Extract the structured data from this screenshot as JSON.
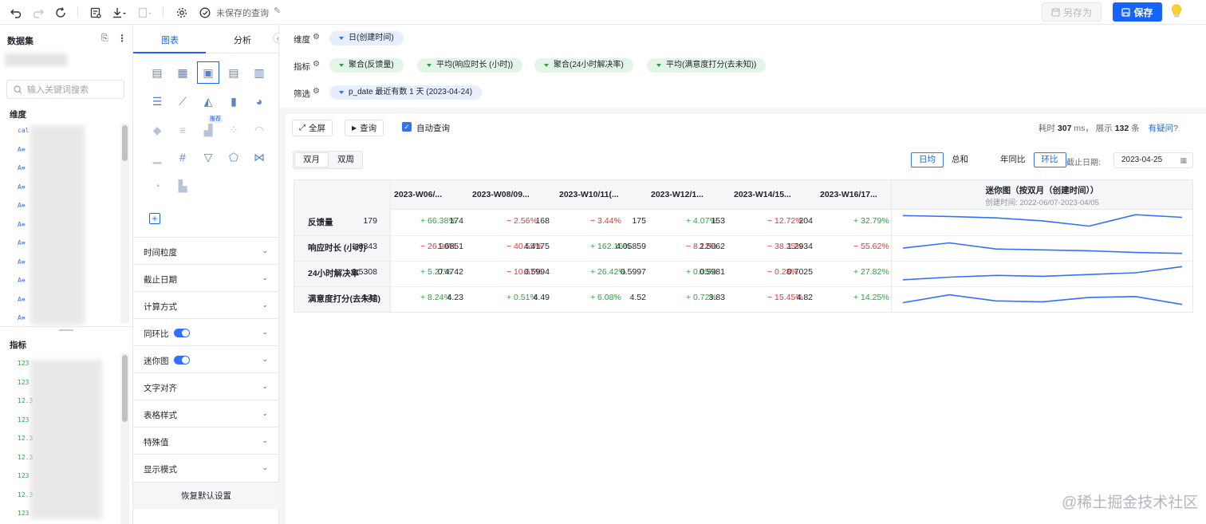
{
  "toolbar": {
    "unsaved_label": "未保存的查询",
    "save_as_label": "另存为",
    "save_label": "保存"
  },
  "left_panel": {
    "title": "数据集",
    "search_placeholder": "输入关键词搜索",
    "dimensions_label": "维度",
    "metrics_label": "指标",
    "dimension_icons": [
      "cal",
      "A≡",
      "A≡",
      "A≡",
      "A≡",
      "A≡",
      "A≡",
      "A≡",
      "A≡",
      "A≡",
      "A≡"
    ],
    "metric_icons": [
      "123",
      "123",
      "12.3",
      "123",
      "12.3",
      "12.3",
      "123",
      "12.3",
      "123"
    ]
  },
  "config_panel": {
    "tabs": [
      "图表",
      "分析"
    ],
    "recommend_badge": "推荐",
    "sections": [
      {
        "label": "时间粒度",
        "toggle": false
      },
      {
        "label": "截止日期",
        "toggle": false
      },
      {
        "label": "计算方式",
        "toggle": false
      },
      {
        "label": "同环比",
        "toggle": true
      },
      {
        "label": "迷你图",
        "toggle": true
      },
      {
        "label": "文字对齐",
        "toggle": false
      },
      {
        "label": "表格样式",
        "toggle": false
      },
      {
        "label": "特殊值",
        "toggle": false
      },
      {
        "label": "显示模式",
        "toggle": false
      }
    ],
    "reset_label": "恢复默认设置"
  },
  "shelves": {
    "dimension": {
      "label": "维度",
      "pills": [
        "日(创建时间)"
      ]
    },
    "metric": {
      "label": "指标",
      "pills": [
        "聚合(反馈量)",
        "平均(响应时长 (小时))",
        "聚合(24小时解决率)",
        "平均(满意度打分(去未知))"
      ]
    },
    "filter": {
      "label": "筛选",
      "pills": [
        "p_date 最近有数 1 天 (2023-04-24)"
      ]
    }
  },
  "query_bar": {
    "fullscreen_label": "全屏",
    "query_label": "查询",
    "auto_query_label": "自动查询",
    "auto_query_checked": true,
    "stats_prefix": "耗时",
    "time_value": "307",
    "time_unit": "ms，",
    "count_prefix": "展示",
    "count_value": "132",
    "count_unit": "条",
    "help_link": "有疑问?"
  },
  "controls": {
    "period_tabs": [
      "双月",
      "双周"
    ],
    "period_selected": "双月",
    "agg_tabs": [
      "日均",
      "总和"
    ],
    "agg_selected": "日均",
    "compare_tabs": [
      "年同比",
      "环比"
    ],
    "compare_selected": "环比",
    "cutoff_label": "截止日期:",
    "cutoff_value": "2023-04-25"
  },
  "table": {
    "columns": [
      "2023-W06/...",
      "2023-W08/09...",
      "2023-W10/11(...",
      "2023-W12/1...",
      "2023-W14/15...",
      "2023-W16/17..."
    ],
    "sparkline_title": "迷你图（按双月（创建时间））",
    "sparkline_subtitle": "创建时间: 2022-06/07-2023-04/05",
    "rows": [
      {
        "label": "反馈量",
        "values": [
          "179",
          "174",
          "168",
          "175",
          "153",
          "204"
        ],
        "changes": [
          "+ 66.38%",
          "− 2.56%",
          "− 3.44%",
          "+ 4.07%",
          "− 12.72%",
          "+ 32.79%"
        ],
        "dirs": [
          "up",
          "down",
          "down",
          "up",
          "down",
          "up"
        ]
      },
      {
        "label": "响应时长 (小时)",
        "values": [
          "1.8343",
          "1.6851",
          "4.4175",
          "4.05859",
          "2.5062",
          "1.2934"
        ],
        "changes": [
          "− 26.90%",
          "− 40.55%",
          "+ 162.16%",
          "− 8.12%",
          "− 38.25%",
          "− 55.62%"
        ],
        "dirs": [
          "down",
          "down",
          "up",
          "down",
          "down",
          "down"
        ]
      },
      {
        "label": "24小时解决率",
        "values": [
          "0.5308",
          "0.4742",
          "0.5994",
          "0.5997",
          "0.5981",
          "0.7025"
        ],
        "changes": [
          "+ 5.27%",
          "− 10.67%",
          "+ 26.42%",
          "+ 0.05%",
          "− 0.28%",
          "+ 27.82%"
        ],
        "dirs": [
          "up",
          "down",
          "up",
          "up",
          "down",
          "up"
        ]
      },
      {
        "label": "满意度打分(去未知)",
        "values": [
          "4.21",
          "4.23",
          "4.49",
          "4.52",
          "3.83",
          "4.82"
        ],
        "changes": [
          "+ 8.24%",
          "+ 0.51%",
          "+ 6.08%",
          "+ 0.72%",
          "− 15.45%",
          "+ 14.25%"
        ],
        "dirs": [
          "up",
          "up",
          "up",
          "up",
          "down",
          "up"
        ]
      }
    ],
    "sparklines": [
      [
        0.85,
        0.8,
        0.72,
        0.55,
        0.25,
        0.9,
        0.75
      ],
      [
        0.45,
        0.75,
        0.4,
        0.35,
        0.3,
        0.2,
        0.15
      ],
      [
        0.1,
        0.25,
        0.35,
        0.3,
        0.4,
        0.5,
        0.85
      ],
      [
        0.25,
        0.7,
        0.35,
        0.3,
        0.55,
        0.6,
        0.15
      ]
    ],
    "sparkline_color": "#3370ff"
  },
  "watermark": "@稀土掘金技术社区"
}
